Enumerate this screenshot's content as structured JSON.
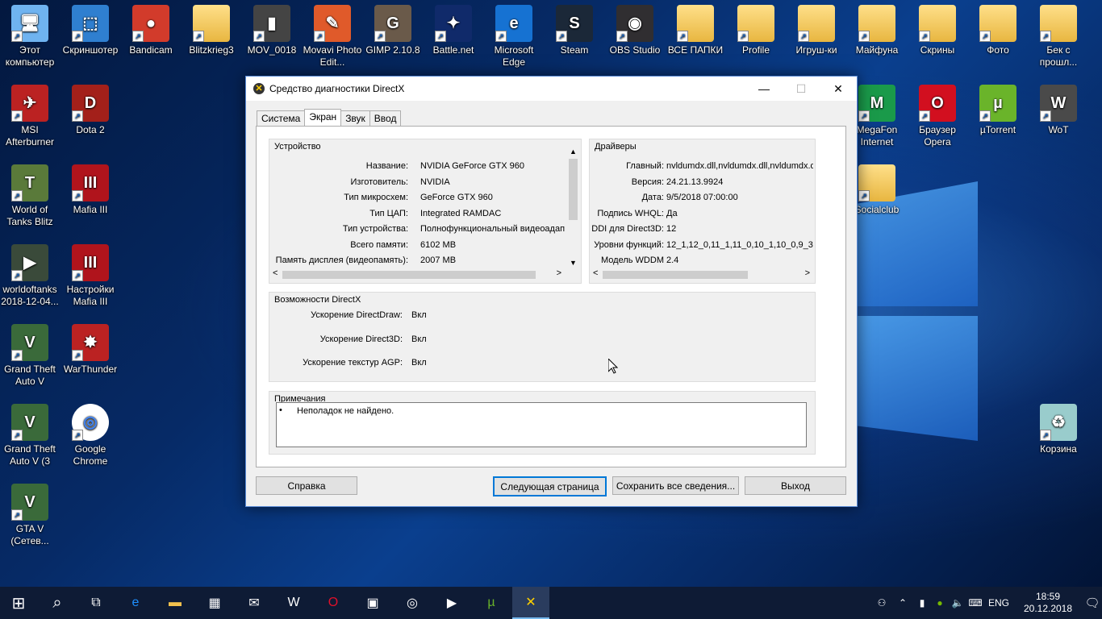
{
  "desktop": {
    "icons": [
      {
        "label": "Этот компьютер",
        "glyph": "🖥"
      },
      {
        "label": "Скриншотер",
        "glyph": "⬚"
      },
      {
        "label": "Bandicam",
        "glyph": "●"
      },
      {
        "label": "Blitzkrieg3",
        "glyph": ""
      },
      {
        "label": "MOV_0018",
        "glyph": "▮"
      },
      {
        "label": "Movavi Photo Edit...",
        "glyph": "✎"
      },
      {
        "label": "GIMP 2.10.8",
        "glyph": "G"
      },
      {
        "label": "Battle.net",
        "glyph": "✦"
      },
      {
        "label": "Microsoft Edge",
        "glyph": "e"
      },
      {
        "label": "Steam",
        "glyph": "S"
      },
      {
        "label": "OBS Studio",
        "glyph": "◉"
      },
      {
        "label": "ВСЕ ПАПКИ",
        "glyph": ""
      },
      {
        "label": "Profile",
        "glyph": ""
      },
      {
        "label": "Игруш-ки",
        "glyph": ""
      },
      {
        "label": "Майфуна",
        "glyph": ""
      },
      {
        "label": "Скрины",
        "glyph": ""
      },
      {
        "label": "Фото",
        "glyph": ""
      },
      {
        "label": "Бек с прошл...",
        "glyph": ""
      },
      {
        "label": "MSI Afterburner",
        "glyph": "✈"
      },
      {
        "label": "Dota 2",
        "glyph": "D"
      },
      {
        "label": "World of Tanks Blitz",
        "glyph": "T"
      },
      {
        "label": "Mafia III",
        "glyph": "III"
      },
      {
        "label": "worldoftanks 2018-12-04...",
        "glyph": "▶"
      },
      {
        "label": "Настройки Mafia III",
        "glyph": "III"
      },
      {
        "label": "Grand Theft Auto V",
        "glyph": "V"
      },
      {
        "label": "WarThunder",
        "glyph": "✸"
      },
      {
        "label": "Grand Theft Auto V (3",
        "glyph": "V"
      },
      {
        "label": "Google Chrome",
        "glyph": "◎"
      },
      {
        "label": "GTA V (Сетев...",
        "glyph": "V"
      },
      {
        "label": "MegaFon Internet",
        "glyph": "M"
      },
      {
        "label": "Браузер Opera",
        "glyph": "O"
      },
      {
        "label": "µTorrent",
        "glyph": "µ"
      },
      {
        "label": "WoT",
        "glyph": "W"
      },
      {
        "label": "Socialclub",
        "glyph": ""
      },
      {
        "label": "Корзина",
        "glyph": "♻"
      }
    ]
  },
  "window": {
    "title": "Средство диагностики DirectX",
    "minimize_glyph": "—",
    "maximize_glyph": "☐",
    "close_glyph": "✕",
    "tabs": [
      "Система",
      "Экран",
      "Звук",
      "Ввод"
    ],
    "active_tab": "Экран",
    "device": {
      "title": "Устройство",
      "rows": [
        {
          "label": "Название:",
          "value": "NVIDIA GeForce GTX 960"
        },
        {
          "label": "Изготовитель:",
          "value": "NVIDIA"
        },
        {
          "label": "Тип микросхем:",
          "value": "GeForce GTX 960"
        },
        {
          "label": "Тип ЦАП:",
          "value": "Integrated RAMDAC"
        },
        {
          "label": "Тип устройства:",
          "value": "Полнофункциональный видеоадап"
        },
        {
          "label": "Всего памяти:",
          "value": "6102 MB"
        },
        {
          "label": "Память дисплея (видеопамять):",
          "value": "2007 MB"
        }
      ]
    },
    "drivers": {
      "title": "Драйверы",
      "rows": [
        {
          "label": "Главный:",
          "value": "nvldumdx.dll,nvldumdx.dll,nvldumdx.d"
        },
        {
          "label": "Версия:",
          "value": "24.21.13.9924"
        },
        {
          "label": "Дата:",
          "value": "9/5/2018 07:00:00"
        },
        {
          "label": "Подпись WHQL:",
          "value": "Да"
        },
        {
          "label": "DDI для Direct3D:",
          "value": "12"
        },
        {
          "label": "Уровни функций:",
          "value": "12_1,12_0,11_1,11_0,10_1,10_0,9_3"
        },
        {
          "label": "Модель WDDM",
          "value": "2.4"
        }
      ]
    },
    "features": {
      "title": "Возможности DirectX",
      "rows": [
        {
          "label": "Ускорение DirectDraw:",
          "value": "Вкл"
        },
        {
          "label": "Ускорение Direct3D:",
          "value": "Вкл"
        },
        {
          "label": "Ускорение текстур AGP:",
          "value": "Вкл"
        }
      ]
    },
    "notes": {
      "title": "Примечания",
      "items": [
        "Неполадок не найдено."
      ]
    },
    "buttons": {
      "help": "Справка",
      "next": "Следующая страница",
      "save": "Сохранить все сведения...",
      "exit": "Выход"
    }
  },
  "taskbar": {
    "start_glyph": "⊞",
    "search_glyph": "⌕",
    "items": [
      "task-view",
      "edge",
      "explorer",
      "store",
      "mail",
      "wot",
      "opera",
      "control-panel",
      "steam-like",
      "movies",
      "utorrent",
      "directx"
    ],
    "lang": "ENG",
    "time": "18:59",
    "date": "20.12.2018"
  },
  "colors": {
    "accent": "#0078d7",
    "taskbar": "#0e1b35"
  }
}
